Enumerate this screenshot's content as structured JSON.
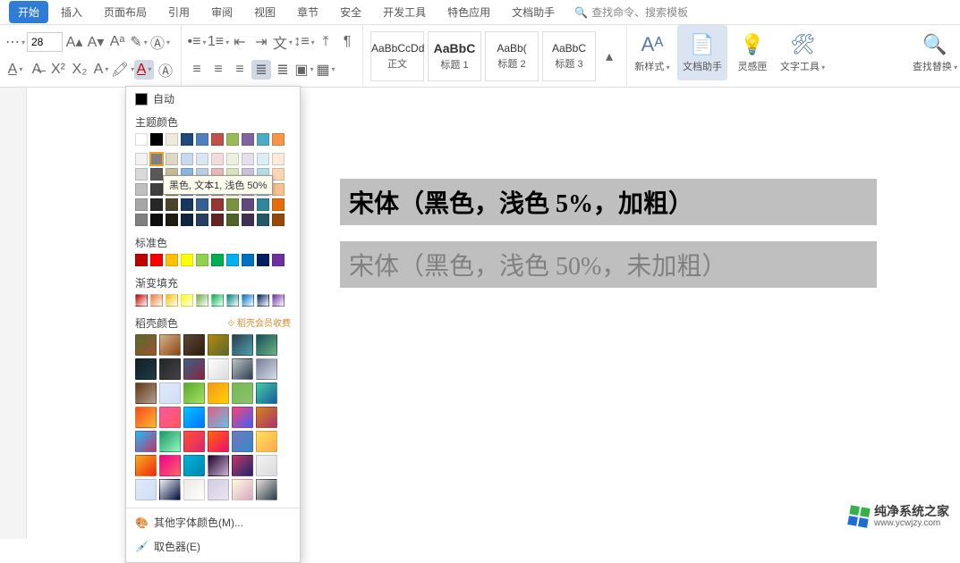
{
  "tabs": {
    "items": [
      "开始",
      "插入",
      "页面布局",
      "引用",
      "审阅",
      "视图",
      "章节",
      "安全",
      "开发工具",
      "特色应用",
      "文档助手"
    ],
    "active_index": 0,
    "search_hint": "查找命令、搜索模板"
  },
  "ribbon": {
    "font_size": "28",
    "styles": [
      {
        "sample": "AaBbCcDd",
        "label": "正文"
      },
      {
        "sample": "AaBbC",
        "label": "标题 1",
        "bold": true
      },
      {
        "sample": "AaBb(",
        "label": "标题 2"
      },
      {
        "sample": "AaBbC",
        "label": "标题 3"
      }
    ],
    "new_style": "新样式",
    "doc_assist": "文档助手",
    "inspire": "灵感匣",
    "text_tool": "文字工具",
    "find_replace": "查找替换"
  },
  "color_popup": {
    "auto": "自动",
    "theme_label": "主题颜色",
    "theme_row0": [
      "#ffffff",
      "#000000",
      "#eeece1",
      "#1f497d",
      "#4f81bd",
      "#c0504d",
      "#9bbb59",
      "#8064a2",
      "#4bacc6",
      "#f79646"
    ],
    "theme_matrix": [
      [
        "#f2f2f2",
        "#808080",
        "#ddd9c3",
        "#c6d9f1",
        "#dce6f2",
        "#f2dcdb",
        "#ebf1dd",
        "#e6e0ec",
        "#dbeef4",
        "#fdeada"
      ],
      [
        "#d9d9d9",
        "#595959",
        "#c4bd97",
        "#8eb4e3",
        "#b9cde5",
        "#e6b8b7",
        "#d7e4bd",
        "#ccc1da",
        "#b7dee8",
        "#fcd5b5"
      ],
      [
        "#bfbfbf",
        "#404040",
        "#948a54",
        "#548ed5",
        "#95b3d7",
        "#da9694",
        "#c3d69b",
        "#b3a2c7",
        "#93cddd",
        "#fac090"
      ],
      [
        "#a6a6a6",
        "#262626",
        "#4a452a",
        "#17375e",
        "#376092",
        "#953735",
        "#77933c",
        "#604a7b",
        "#31859c",
        "#e46c0a"
      ],
      [
        "#808080",
        "#0d0d0d",
        "#1e1c11",
        "#10243f",
        "#254061",
        "#632523",
        "#4f6228",
        "#403152",
        "#215968",
        "#984807"
      ]
    ],
    "tooltip": "黑色, 文本1, 浅色 50%",
    "standard_label": "标准色",
    "standard": [
      "#c00000",
      "#ff0000",
      "#ffc000",
      "#ffff00",
      "#92d050",
      "#00b050",
      "#00b0f0",
      "#0070c0",
      "#002060",
      "#7030a0"
    ],
    "gradient_label": "渐变填充",
    "gradients": [
      "#c00000",
      "#ed7d31",
      "#ffc000",
      "#ffff00",
      "#70ad47",
      "#00b050",
      "#008080",
      "#0070c0",
      "#002060",
      "#7030a0"
    ],
    "doke_label": "稻壳颜色",
    "doke_vip": "稻壳会员收费",
    "doke_gradients": [
      [
        "#556b2f,#a0522d",
        "#d2b48c,#8b4513",
        "#5b4636,#2f1b0c",
        "#b8860b,#556b2f",
        "#2c3e50,#4ca1af",
        "#134e5e,#71b280",
        "#0f2027,#203a43"
      ],
      [
        "#232526,#414345",
        "#3a6186,#89253e",
        "#ffffff,#dcdcdc",
        "#bdc3c7,#2c3e50",
        "#757f9a,#d7dde8",
        "#603813,#b29f94",
        "#e0eafc,#cfdef3"
      ],
      [
        "#56ab2f,#a8e063",
        "#f7971e,#ffd200",
        "#76b852,#8dc26f",
        "#43cea2,#185a9d",
        "#fc4a1a,#f7b733",
        "#f857a6,#ff5858",
        "#00c6ff,#0072ff"
      ],
      [
        "#e55d87,#5fc3e4",
        "#fc466b,#3f5efb",
        "#d38312,#a83279",
        "#16bffd,#cb3066",
        "#1d976c,#93f9b9",
        "#ff512f,#dd2476",
        "#ff6a00,#ee0979"
      ],
      [
        "#7474bf,#348ac7",
        "#ffe259,#ffa751",
        "#f5af19,#f12711",
        "#ec008c,#fc6767",
        "#00b4db,#0083b0",
        "#20002c,#cbb4d4",
        "#c33764,#1d2671"
      ],
      [
        "#f2f2f2,#dbdbdb",
        "#e0eafc,#cfdef3",
        "#f0f2f0,#000c40",
        "#ece9e6,#ffffff",
        "#d3cce3,#e9e4f0",
        "#fffcdc,#d9a7c7",
        "#e6dada,#274046"
      ]
    ],
    "more_colors": "其他字体颜色(M)...",
    "eyedropper": "取色器(E)"
  },
  "document": {
    "line1": "宋体（黑色，浅色 5%，加粗）",
    "line2": "宋体（黑色，浅色 50%，未加粗）"
  },
  "watermark": {
    "title": "纯净系统之家",
    "url": "www.ycwjzy.com"
  }
}
